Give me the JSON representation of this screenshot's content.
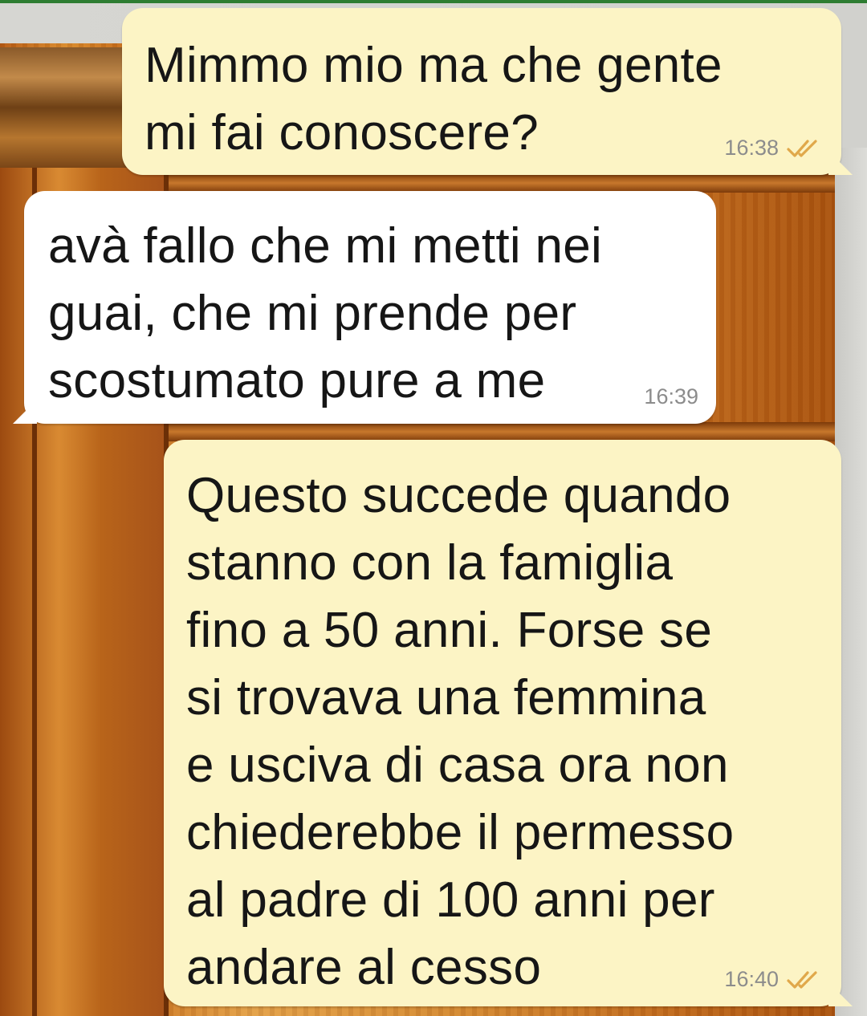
{
  "chat": {
    "messages": [
      {
        "direction": "outgoing",
        "text": "Mimmo mio ma che gente\nmi fai conoscere?",
        "time": "16:38",
        "status_icon": "double-check-icon"
      },
      {
        "direction": "incoming",
        "text": "avà fallo che mi metti nei\nguai, che mi prende per\nscostumato pure a me",
        "time": "16:39"
      },
      {
        "direction": "outgoing",
        "text": "Questo succede quando\nstanno con la famiglia\nfino a 50 anni. Forse se\nsi trovava una femmina\ne usciva di casa ora non\nchiederebbe il permesso\nal padre di 100 anni per\nandare al cesso",
        "time": "16:40",
        "status_icon": "double-check-icon"
      }
    ]
  },
  "colors": {
    "outgoing_bubble": "#fcf4c5",
    "incoming_bubble": "#ffffff",
    "timestamp": "#8c8c8c",
    "read_ticks": "#e0a84a"
  }
}
